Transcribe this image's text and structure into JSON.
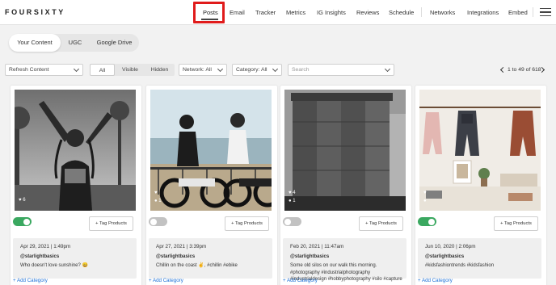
{
  "brand": "FOURSIXTY",
  "nav": [
    {
      "label": "Posts",
      "active": true
    },
    {
      "label": "Email"
    },
    {
      "label": "Tracker"
    },
    {
      "label": "Metrics"
    },
    {
      "label": "IG Insights"
    },
    {
      "label": "Reviews"
    },
    {
      "label": "Schedule"
    },
    {
      "label": "Networks"
    },
    {
      "label": "Integrations"
    },
    {
      "label": "Embed"
    }
  ],
  "source_tabs": [
    "Your Content",
    "UGC",
    "Google Drive"
  ],
  "filters": {
    "refresh": "Refresh Content",
    "visibility": [
      "All",
      "Visible",
      "Hidden"
    ],
    "network": "Network: All",
    "category": "Category: All",
    "search_placeholder": "Search",
    "pagination": "1 to 49 of 618"
  },
  "posts": [
    {
      "likes": "6",
      "comments": "",
      "enabled": true,
      "tag_label": "+ Tag Products",
      "date": "Apr 29, 2021 | 1:49pm",
      "user": "@starlightbasics",
      "caption": "Who doesn't love sunshine? 😀",
      "add_category": "+ Add Category"
    },
    {
      "likes": "",
      "comments": "1",
      "enabled": false,
      "tag_label": "+ Tag Products",
      "date": "Apr 27, 2021 | 3:39pm",
      "user": "@starlightbasics",
      "caption": "Chillin on the coast ✌️, #chillin #ebike",
      "add_category": "+ Add Category"
    },
    {
      "likes": "4",
      "comments": "1",
      "enabled": false,
      "tag_label": "+ Tag Products",
      "date": "Feb 20, 2021 | 11:47am",
      "user": "@starlightbasics",
      "caption": "Some old silos on our walk this morning. #photography #industrialphotography #industrialdesign #hobbyphotography #silo #capture",
      "add_category": "+ Add Category"
    },
    {
      "likes": "",
      "comments": "",
      "enabled": true,
      "tag_label": "+ Tag Products",
      "date": "Jun 10, 2020 | 2:06pm",
      "user": "@starlightbasics",
      "caption": "#kidsfashiontrends #kidsfashion",
      "add_category": "+ Add Category"
    }
  ],
  "colors": {
    "highlight": "#e01b1b",
    "toggle_on": "#3aa860",
    "link": "#1a6fd6"
  }
}
